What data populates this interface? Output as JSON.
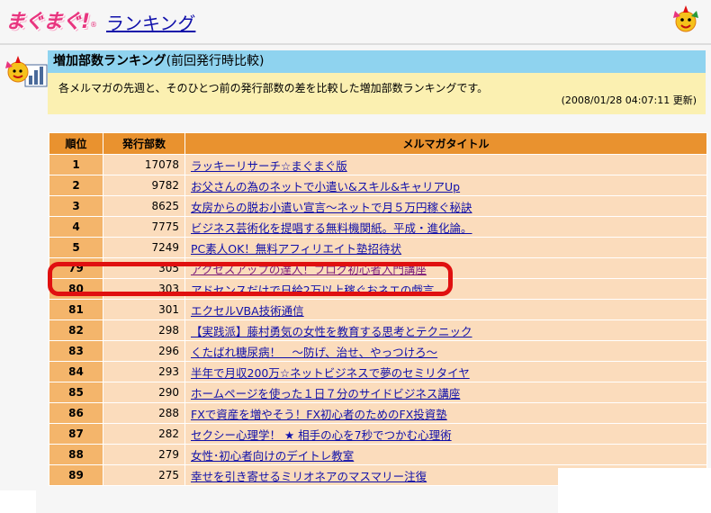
{
  "header": {
    "logo_text": "まぐまぐ!",
    "logo_reg": "®",
    "title": "ランキング"
  },
  "banner": {
    "title": "増加部数ランキング",
    "subtitle": "(前回発行時比較)"
  },
  "description": {
    "text": "各メルマガの先週と、そのひとつ前の発行部数の差を比較した増加部数ランキングです。",
    "updated": "(2008/01/28 04:07:11 更新)"
  },
  "table": {
    "headers": [
      "順位",
      "発行部数",
      "メルマガタイトル"
    ],
    "rows": [
      {
        "rank": "1",
        "count": "17078",
        "title": "ラッキーリサーチ☆まぐまぐ版"
      },
      {
        "rank": "2",
        "count": "9782",
        "title": "お父さんの為のネットで小遣い&スキル&キャリアUp"
      },
      {
        "rank": "3",
        "count": "8625",
        "title": "女房からの脱お小遣い宣言～ネットで月５万円稼ぐ秘訣"
      },
      {
        "rank": "4",
        "count": "7775",
        "title": "ビジネス芸術化を提唱する無料機関紙。平成・進化論。"
      },
      {
        "rank": "5",
        "count": "7249",
        "title": "PC素人OK！無料アフィリエイト塾招待状"
      },
      {
        "rank": "79",
        "count": "305",
        "title": "アクセスアップの達人！ブログ初心者入門講座"
      },
      {
        "rank": "80",
        "count": "303",
        "title": "アドセンスだけで日給2万以上稼ぐおネエの戯言"
      },
      {
        "rank": "81",
        "count": "301",
        "title": "エクセルVBA技術通信"
      },
      {
        "rank": "82",
        "count": "298",
        "title": "【実践派】藤村勇気の女性を教育する思考とテクニック"
      },
      {
        "rank": "83",
        "count": "296",
        "title": "くたばれ糖尿病！　～防げ、治せ、やっつけろ～"
      },
      {
        "rank": "84",
        "count": "293",
        "title": "半年で月収200万☆ネットビジネスで夢のセミリタイヤ"
      },
      {
        "rank": "85",
        "count": "290",
        "title": "ホームページを使った１日７分のサイドビジネス講座"
      },
      {
        "rank": "86",
        "count": "288",
        "title": "FXで資産を増やそう！FX初心者のためのFX投資塾"
      },
      {
        "rank": "87",
        "count": "282",
        "title": "セクシー心理学！ ★ 相手の心を7秒でつかむ心理術"
      },
      {
        "rank": "88",
        "count": "279",
        "title": "女性･初心者向けのデイトレ教室"
      },
      {
        "rank": "89",
        "count": "275",
        "title": "幸せを引き寄せるミリオネアのマスマリー注復"
      }
    ]
  },
  "colors": {
    "accent_red": "#e01010",
    "banner_blue": "#8fd3ef",
    "header_orange": "#e9922f",
    "rank_orange": "#f4b56b",
    "row_peach": "#fbdcbc",
    "desc_yellow": "#fbf0b1",
    "link_blue": "#1010aa"
  },
  "icons": [
    "mascot-icon",
    "ranking-chart-icon"
  ]
}
